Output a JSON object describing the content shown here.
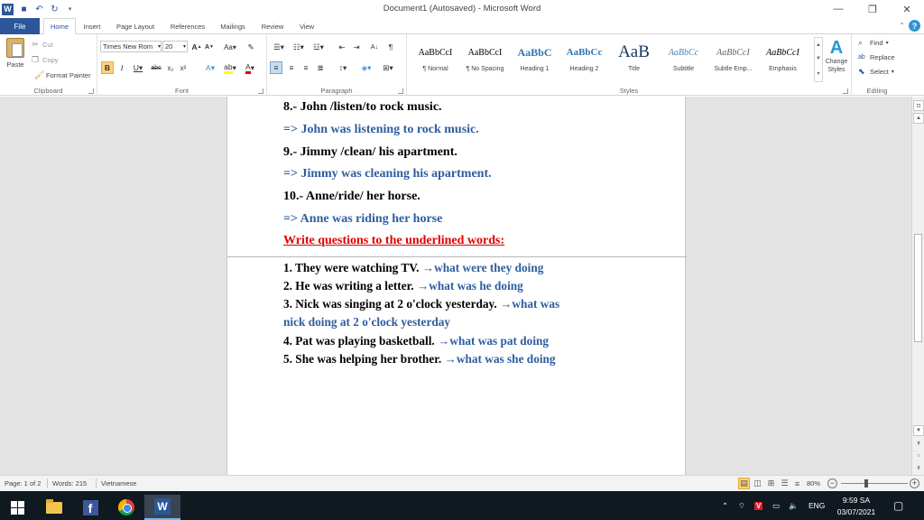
{
  "window": {
    "title": "Document1 (Autosaved) - Microsoft Word",
    "minimize": "—",
    "restore": "❐",
    "close": "✕"
  },
  "tabs": {
    "file": "File",
    "home": "Home",
    "insert": "Insert",
    "page_layout": "Page Layout",
    "references": "References",
    "mailings": "Mailings",
    "review": "Review",
    "view": "View"
  },
  "ribbon": {
    "clipboard": {
      "label": "Clipboard",
      "paste": "Paste",
      "cut": "Cut",
      "copy": "Copy",
      "format_painter": "Format Painter"
    },
    "font": {
      "label": "Font",
      "family": "Times New Rom",
      "size": "20"
    },
    "paragraph": {
      "label": "Paragraph"
    },
    "styles": {
      "label": "Styles",
      "items": [
        {
          "preview": "AaBbCcI",
          "name": "¶ Normal"
        },
        {
          "preview": "AaBbCcI",
          "name": "¶ No Spacing"
        },
        {
          "preview": "AaBbC",
          "name": "Heading 1"
        },
        {
          "preview": "AaBbCc",
          "name": "Heading 2"
        },
        {
          "preview": "AaB",
          "name": "Title"
        },
        {
          "preview": "AaBbCc",
          "name": "Subtitle"
        },
        {
          "preview": "AaBbCcI",
          "name": "Subtle Emp..."
        },
        {
          "preview": "AaBbCcI",
          "name": "Emphasis"
        }
      ],
      "change_styles": "Change Styles"
    },
    "editing": {
      "label": "Editing",
      "find": "Find",
      "replace": "Replace",
      "select": "Select"
    }
  },
  "document": {
    "lines": [
      "8.- John /listen/to rock music.",
      "=> John was listening to rock music.",
      "9.- Jimmy /clean/ his apartment.",
      "=> Jimmy was cleaning his apartment.",
      "10.- Anne/ride/ her horse.",
      "=> Anne was riding her horse",
      "Write questions to the underlined words:"
    ],
    "questions": [
      {
        "q": "1. They were watching TV. ",
        "a": "→what were they doing"
      },
      {
        "q": "2. He was writing a letter. ",
        "a": "→what was he doing"
      },
      {
        "q": "3. Nick was singing at 2 o'clock yesterday. ",
        "a": "→what was"
      },
      {
        "q": "",
        "a": "nick doing at  2 o'clock yesterday"
      },
      {
        "q": "4. Pat was playing basketball. ",
        "a": "→what was pat doing"
      },
      {
        "q": "5. She was helping her brother. ",
        "a": "→what was she doing"
      }
    ]
  },
  "status": {
    "page": "Page: 1 of 2",
    "words": "Words: 215",
    "language": "Vietnamese",
    "zoom": "80%"
  },
  "taskbar": {
    "lang": "ENG",
    "time": "9:59 SA",
    "date": "03/07/2021"
  }
}
